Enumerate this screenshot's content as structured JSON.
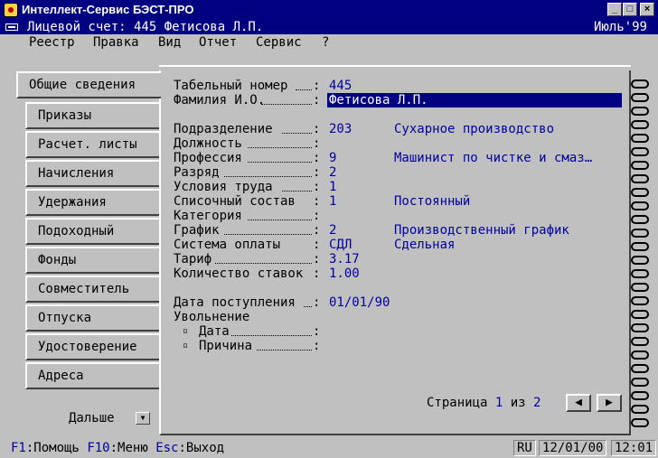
{
  "window": {
    "title": "Интеллект-Сервис БЭСТ-ПРО"
  },
  "record": {
    "account": "Лицевой счет: 445 Фетисова Л.П.",
    "period": "Июль'99"
  },
  "menu": [
    "Реестр",
    "Правка",
    "Вид",
    "Отчет",
    "Сервис",
    "?"
  ],
  "tabs": [
    "Общие сведения",
    "Приказы",
    "Расчет. листы",
    "Начисления",
    "Удержания",
    "Подоходный",
    "Фонды",
    "Совместитель",
    "Отпуска",
    "Удостоверение",
    "Адреса"
  ],
  "more_label": "Дальше",
  "fields": {
    "tab_number": {
      "label": "Табельный номер",
      "value": "445"
    },
    "full_name": {
      "label": "Фамилия И.О.",
      "value": "Фетисова Л.П."
    },
    "department": {
      "label": "Подразделение",
      "code": "203",
      "name": "Сухарное производство"
    },
    "position": {
      "label": "Должность"
    },
    "profession": {
      "label": "Профессия",
      "code": "9",
      "name": "Машинист по чистке и смаз…"
    },
    "grade": {
      "label": "Разряд",
      "value": "2"
    },
    "work_conditions": {
      "label": "Условия труда",
      "value": "1"
    },
    "staff_list": {
      "label": "Списочный состав",
      "code": "1",
      "name": "Постоянный"
    },
    "category": {
      "label": "Категория"
    },
    "schedule": {
      "label": "График",
      "code": "2",
      "name": "Производственный график"
    },
    "pay_system": {
      "label": "Система оплаты",
      "code": "СДЛ",
      "name": "Сдельная"
    },
    "tariff": {
      "label": "Тариф",
      "value": "3.17"
    },
    "rates": {
      "label": "Количество ставок",
      "value": "1.00"
    },
    "hire_date": {
      "label": "Дата поступления",
      "value": "01/01/90"
    },
    "dismissal": {
      "label": "Увольнение"
    },
    "dismissal_date": {
      "label": "Дата"
    },
    "dismissal_reason": {
      "label": "Причина"
    }
  },
  "pager": {
    "label": "Страница",
    "current": "1",
    "of": "из",
    "total": "2"
  },
  "status": {
    "f1_key": "F1",
    "f1_label": ":Помощь",
    "f10_key": "F10",
    "f10_label": ":Меню",
    "esc_key": "Esc",
    "esc_label": ":Выход",
    "lang": "RU",
    "date": "12/01/00",
    "time": "12:01"
  }
}
